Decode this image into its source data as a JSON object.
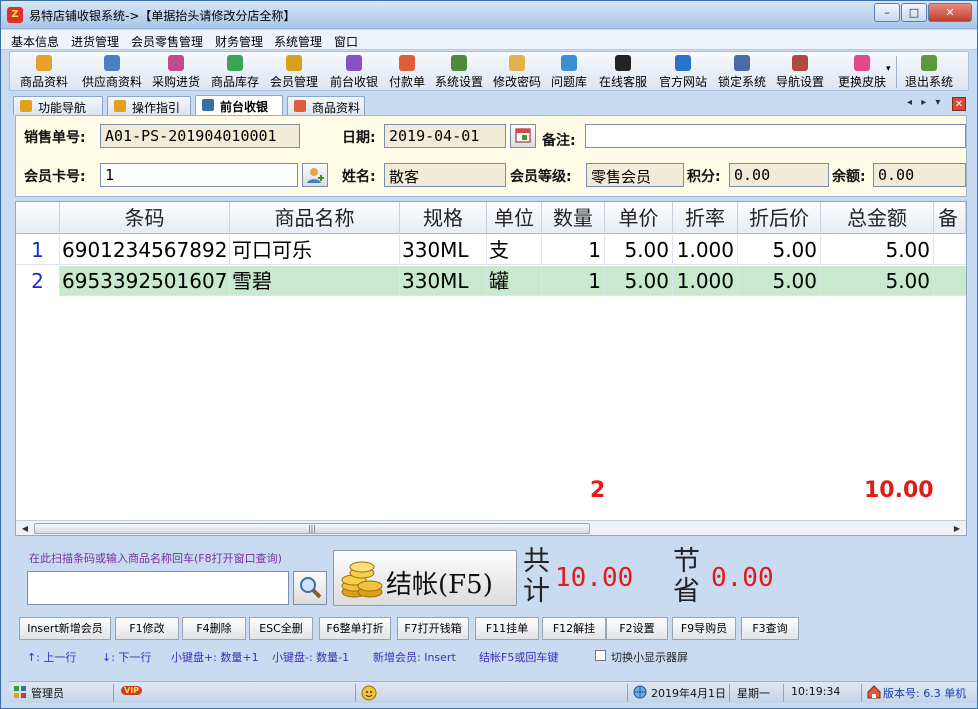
{
  "window": {
    "title": "易特店铺收银系统->【单据抬头请修改分店全称】",
    "app_icon": "Z",
    "controls": {
      "minimize": "–",
      "maximize": "□",
      "close": "✕"
    }
  },
  "menubar": [
    "基本信息",
    "进货管理",
    "会员零售管理",
    "财务管理",
    "系统管理",
    "窗口"
  ],
  "toolbar": [
    {
      "label": "商品资料",
      "icon": "goods-icon",
      "color": "#e8a12b"
    },
    {
      "label": "供应商资料",
      "icon": "supplier-icon",
      "color": "#4a7fc4"
    },
    {
      "label": "采购进货",
      "icon": "purchase-icon",
      "color": "#c24b8a"
    },
    {
      "label": "商品库存",
      "icon": "inventory-icon",
      "color": "#3aa357"
    },
    {
      "label": "会员管理",
      "icon": "member-icon",
      "color": "#d9a11c"
    },
    {
      "label": "前台收银",
      "icon": "cashier-icon",
      "color": "#8a4fc2"
    },
    {
      "label": "付款单",
      "icon": "payment-icon",
      "color": "#e05c3a"
    },
    {
      "label": "系统设置",
      "icon": "settings-icon",
      "color": "#4f8a3a"
    },
    {
      "label": "修改密码",
      "icon": "password-icon",
      "color": "#e2b24a"
    },
    {
      "label": "问题库",
      "icon": "question-icon",
      "color": "#3a8fd1"
    },
    {
      "label": "在线客服",
      "icon": "support-icon",
      "color": "#222222"
    },
    {
      "label": "官方网站",
      "icon": "website-icon",
      "color": "#2a72c9"
    },
    {
      "label": "锁定系统",
      "icon": "lock-icon",
      "color": "#4a6aa8"
    },
    {
      "label": "导航设置",
      "icon": "navigation-icon",
      "color": "#b04a3a"
    },
    {
      "label": "更换皮肤",
      "icon": "skin-icon",
      "color": "#e04a8a"
    },
    {
      "label": "退出系统",
      "icon": "exit-icon",
      "color": "#5a9a3a"
    }
  ],
  "tabs": [
    {
      "label": "功能导航",
      "icon": "navigation-icon",
      "active": false
    },
    {
      "label": "操作指引",
      "icon": "guide-icon",
      "active": false
    },
    {
      "label": "前台收银",
      "icon": "cashier-icon",
      "active": true
    },
    {
      "label": "商品资料",
      "icon": "goods-icon",
      "active": false
    }
  ],
  "tab_controls": "◂ ▸ ▾",
  "form": {
    "sale_no_label": "销售单号:",
    "sale_no": "A01-PS-201904010001",
    "date_label": "日期:",
    "date": "2019-04-01",
    "remark_label": "备注:",
    "remark": "",
    "card_label": "会员卡号:",
    "card": "1",
    "name_label": "姓名:",
    "name": "散客",
    "level_label": "会员等级:",
    "level": "零售会员",
    "points_label": "积分:",
    "points": "0.00",
    "balance_label": "余额:",
    "balance": "0.00"
  },
  "grid": {
    "headers": [
      "",
      "条码",
      "商品名称",
      "规格",
      "单位",
      "数量",
      "单价",
      "折率",
      "折后价",
      "总金额",
      "备"
    ],
    "rows": [
      {
        "idx": "1",
        "barcode": "6901234567892",
        "name": "可口可乐",
        "spec": "330ML",
        "unit": "支",
        "qty": "1",
        "price": "5.00",
        "rate": "1.000",
        "disc_price": "5.00",
        "total": "5.00"
      },
      {
        "idx": "2",
        "barcode": "6953392501607",
        "name": "雪碧",
        "spec": "330ML",
        "unit": "罐",
        "qty": "1",
        "price": "5.00",
        "rate": "1.000",
        "disc_price": "5.00",
        "total": "5.00"
      }
    ],
    "total_qty": "2",
    "total_amount": "10.00"
  },
  "bottom": {
    "scan_hint": "在此扫描条码或输入商品名称回车(F8打开窗口查询)",
    "scan_value": "",
    "checkout_label": "结帐(F5)",
    "total_label": "共计",
    "total_value": "10.00",
    "save_label": "节省",
    "save_value": "0.00",
    "fkeys": [
      "Insert新增会员",
      "F1修改",
      "F4删除",
      "ESC全删",
      "F6整单打折",
      "F7打开钱箱",
      "F11挂单",
      "F12解挂",
      "F2设置",
      "F9导购员",
      "F3查询"
    ],
    "hints": [
      "↑: 上一行",
      "↓: 下一行",
      "小键盘+: 数量+1",
      "小键盘-: 数量-1",
      "新增会员: Insert",
      "结帐F5或回车键"
    ],
    "toggle_label": "切换小显示器屏"
  },
  "status": {
    "user": "管理员",
    "vip": "VIP",
    "date": "2019年4月1日",
    "weekday": "星期一",
    "time": "10:19:34",
    "version": "版本号: 6.3 单机"
  }
}
